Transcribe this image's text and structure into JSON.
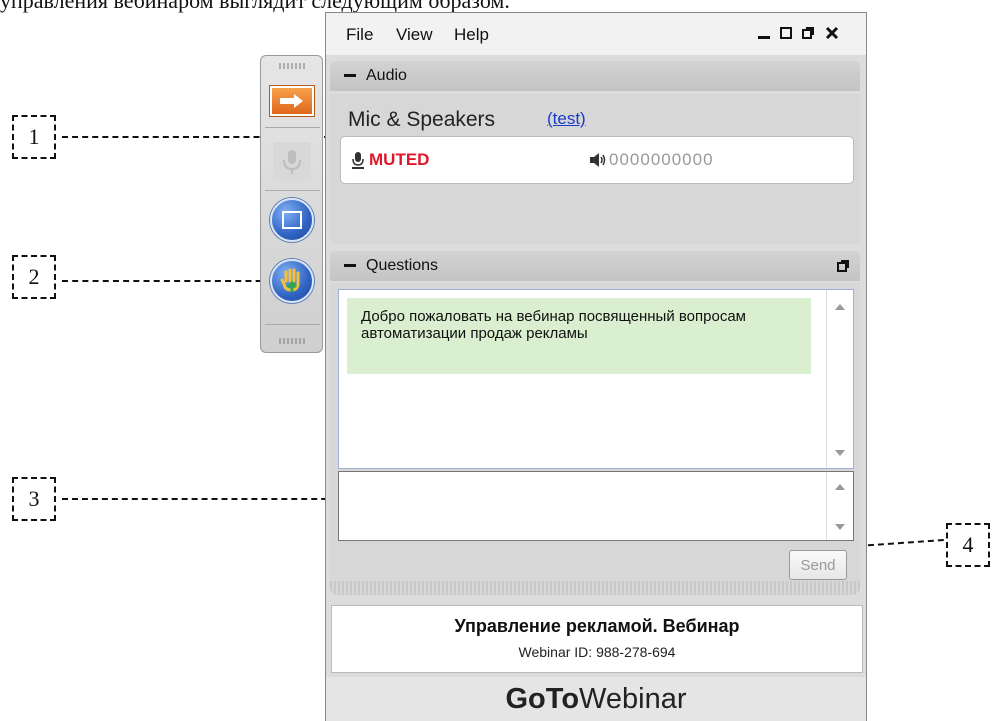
{
  "doc": {
    "top_text": "управления вебинаром выглядит следующим образом."
  },
  "callouts": [
    "1",
    "2",
    "3",
    "4"
  ],
  "menu": [
    "File",
    "View",
    "Help"
  ],
  "window_controls": [
    "minimize-icon",
    "maximize-icon",
    "restore-icon",
    "close-icon"
  ],
  "audio": {
    "title": "Audio",
    "mode": "Mic & Speakers",
    "test_link": "(test)",
    "status": "MUTED",
    "level": "0000000000"
  },
  "questions": {
    "title": "Questions",
    "message": "Добро пожаловать на вебинар посвященный вопросам автоматизации продаж рекламы",
    "input_value": "",
    "send_label": "Send"
  },
  "webinar": {
    "title": "Управление рекламой. Вебинар",
    "id_text": "Webinar ID: 988-278-694"
  },
  "brand": {
    "bold": "GoTo",
    "rest": "Webinar"
  },
  "toolbar_icons": [
    "arrow-icon",
    "microphone-icon",
    "screen-icon",
    "raise-hand-icon"
  ],
  "colors": {
    "muted": "#e0182b",
    "link": "#1a3cc8",
    "message_bg": "#d9efcf",
    "accent_orange": "#e0671c"
  }
}
